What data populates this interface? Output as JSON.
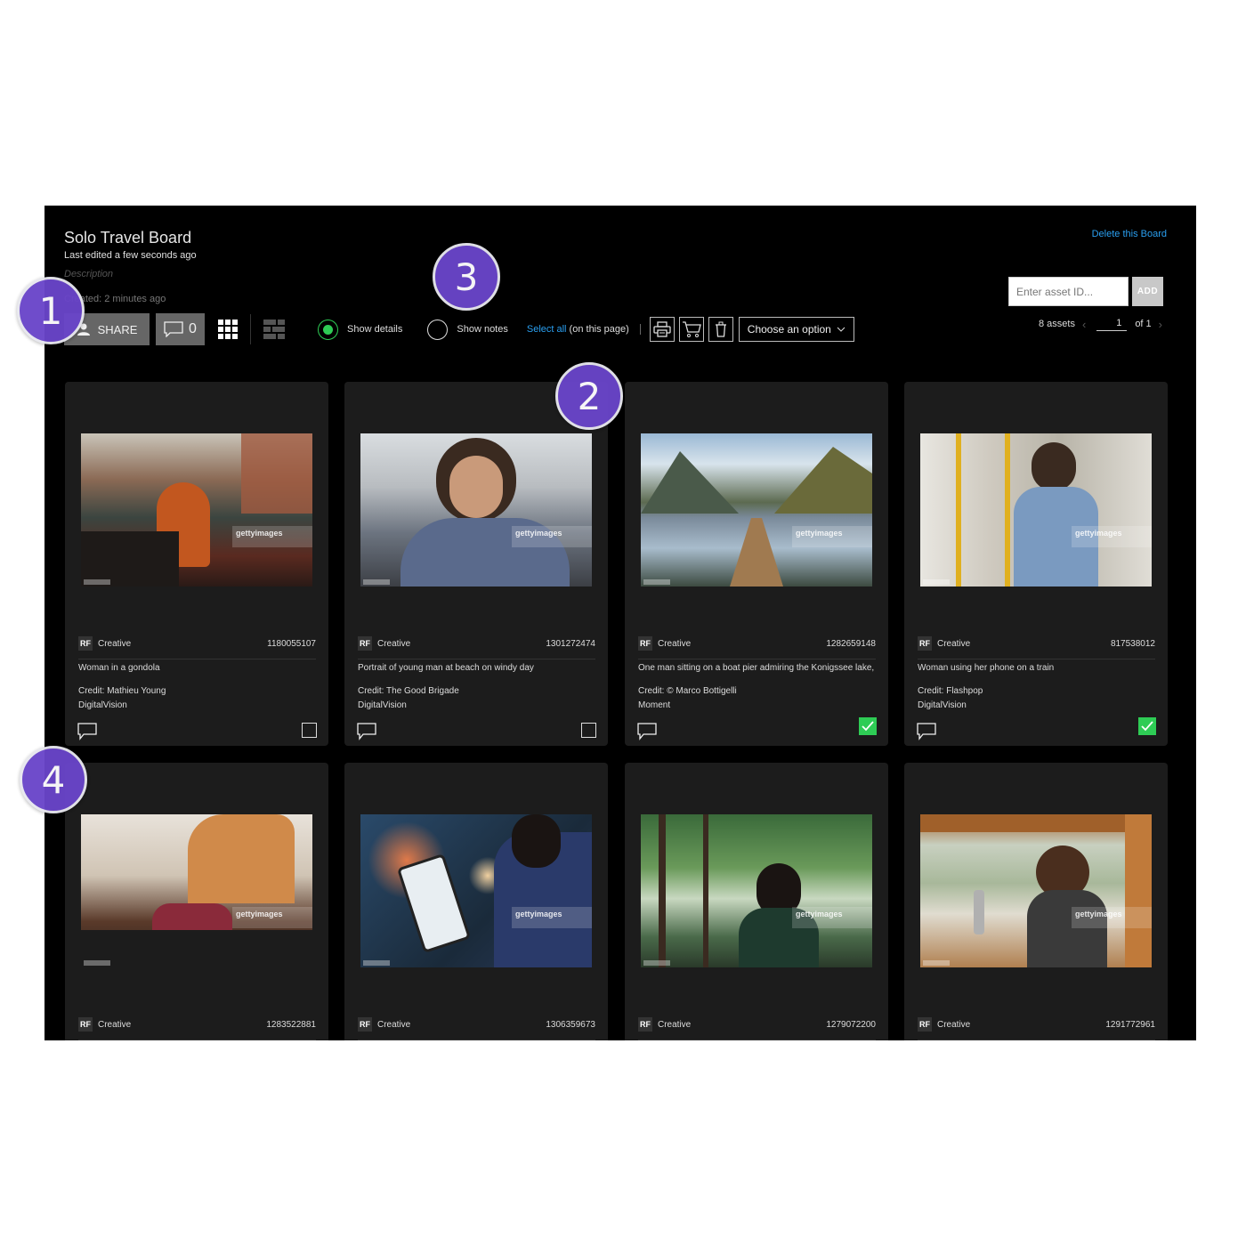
{
  "board": {
    "title": "Solo Travel Board",
    "last_edited": "Last edited a few seconds ago",
    "description_placeholder": "Description",
    "created": "Created: 2 minutes ago",
    "delete_link": "Delete this Board"
  },
  "toolbar": {
    "share_label": "SHARE",
    "comment_count": "0",
    "view_grid_icon": "grid-icon",
    "view_masonry_icon": "masonry-icon",
    "show_details_label": "Show details",
    "show_details_selected": true,
    "show_notes_label": "Show notes",
    "show_notes_selected": false,
    "select_all_link": "Select all",
    "select_all_suffix": " (on this page)",
    "print_icon": "printer-icon",
    "cart_icon": "cart-icon",
    "delete_icon": "trash-icon",
    "choose_option": "Choose an option"
  },
  "asset_add": {
    "placeholder": "Enter asset ID...",
    "value": "",
    "add_label": "ADD"
  },
  "pager": {
    "count": "8 assets",
    "page": "1",
    "of": "of 1"
  },
  "colors": {
    "accent_link": "#2a9ff0",
    "selected_green": "#2ecc55",
    "callout_purple": "#6a45c9"
  },
  "assets": [
    {
      "license": "RF",
      "collection": "Creative",
      "id": "1180055107",
      "caption": "Woman in a gondola",
      "credit": "Credit: Mathieu Young",
      "brand": "DigitalVision",
      "selected": false,
      "watermark": "gettyimages"
    },
    {
      "license": "RF",
      "collection": "Creative",
      "id": "1301272474",
      "caption": "Portrait of young man at beach on windy day",
      "credit": "Credit: The Good Brigade",
      "brand": "DigitalVision",
      "selected": false,
      "watermark": "gettyimages"
    },
    {
      "license": "RF",
      "collection": "Creative",
      "id": "1282659148",
      "caption": "One man sitting on a boat pier admiring the Konigssee lake,",
      "credit": "Credit: © Marco Bottigelli",
      "brand": "Moment",
      "selected": true,
      "watermark": "gettyimages"
    },
    {
      "license": "RF",
      "collection": "Creative",
      "id": "817538012",
      "caption": "Woman using her phone on a train",
      "credit": "Credit: Flashpop",
      "brand": "DigitalVision",
      "selected": true,
      "watermark": "gettyimages"
    },
    {
      "license": "RF",
      "collection": "Creative",
      "id": "1283522881",
      "watermark": "gettyimages"
    },
    {
      "license": "RF",
      "collection": "Creative",
      "id": "1306359673",
      "watermark": "gettyimages"
    },
    {
      "license": "RF",
      "collection": "Creative",
      "id": "1279072200",
      "watermark": "gettyimages"
    },
    {
      "license": "RF",
      "collection": "Creative",
      "id": "1291772961",
      "watermark": "gettyimages"
    }
  ],
  "callouts": [
    "1",
    "2",
    "3",
    "4"
  ]
}
